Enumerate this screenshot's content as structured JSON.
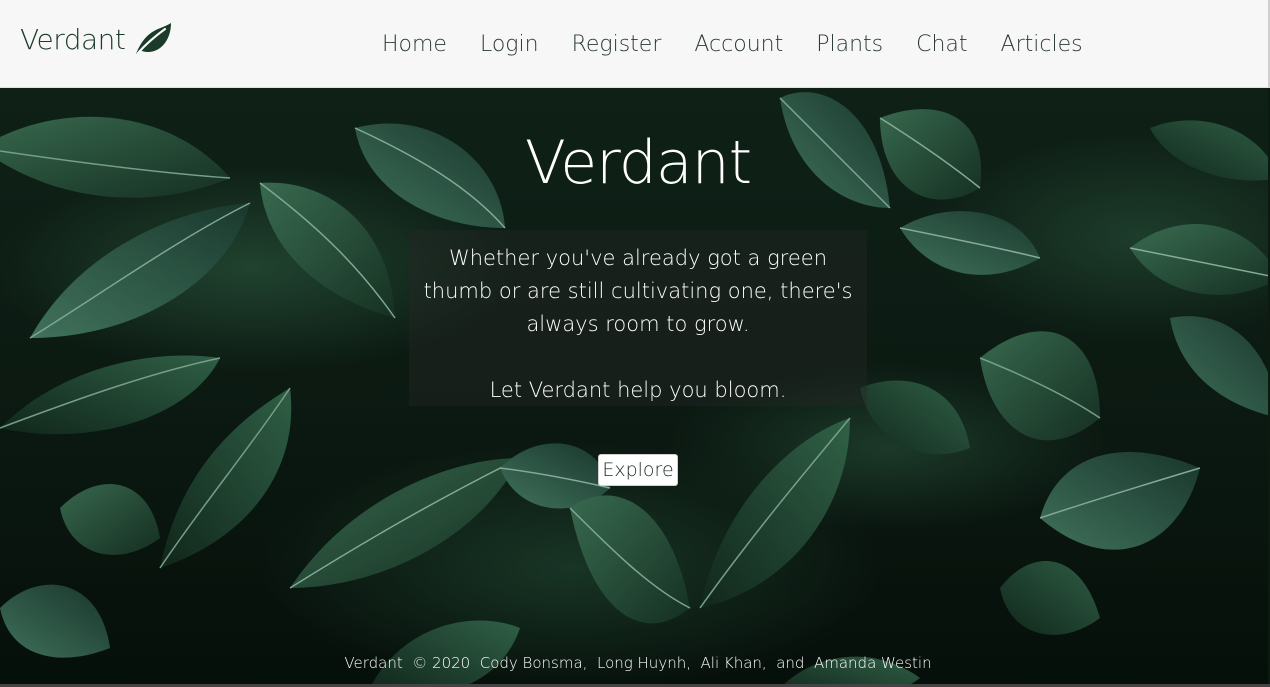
{
  "navbar": {
    "brand": "Verdant",
    "brand_icon": "leaf-icon",
    "links": [
      {
        "label": "Home"
      },
      {
        "label": "Login"
      },
      {
        "label": "Register"
      },
      {
        "label": "Account"
      },
      {
        "label": "Plants"
      },
      {
        "label": "Chat"
      },
      {
        "label": "Articles"
      }
    ]
  },
  "hero": {
    "title": "Verdant",
    "description": "Whether you've already got a green thumb or are still cultivating one, there's always room to grow.",
    "tagline": "Let Verdant help you bloom.",
    "explore_label": "Explore"
  },
  "footer": {
    "text": "Verdant  © 2020  Cody Bonsma,  Long Huynh,  Ali Khan,  and  Amanda Westin"
  },
  "colors": {
    "brand_dark_green": "#1b3a2a",
    "navbar_bg": "#f7f7f7",
    "hero_text": "#ffffff"
  }
}
